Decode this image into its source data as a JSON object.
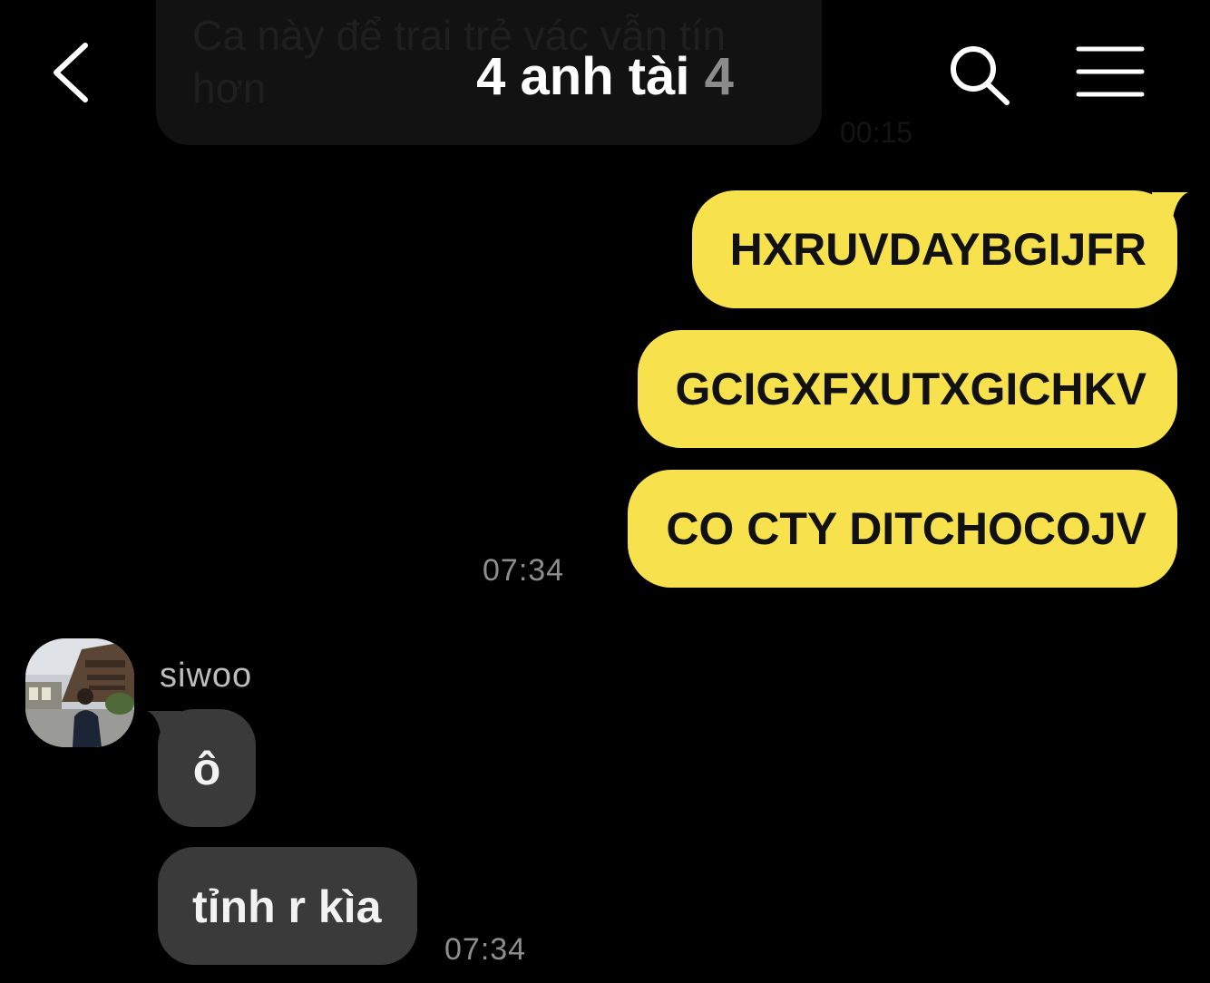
{
  "previous_message": {
    "text": "Ca này để trai trẻ vác vẫn tín hơn",
    "time": "00:15"
  },
  "header": {
    "title": "4 anh tài",
    "member_count": "4",
    "back_icon": "chevron-left-icon",
    "search_icon": "search-icon",
    "menu_icon": "menu-icon"
  },
  "colors": {
    "background": "#000000",
    "outgoing_bubble": "#f7e14c",
    "incoming_bubble": "#3a3a3a",
    "timestamp": "#8e8e8e"
  },
  "outgoing": {
    "messages": [
      "HXRUVDAYBGIJFR",
      "GCIGXFXUTXGICHKV",
      "CO CTY DITCHOCOJV"
    ],
    "time": "07:34"
  },
  "incoming": {
    "sender": "siwoo",
    "messages": [
      "ô",
      "tỉnh r kìa"
    ],
    "time": "07:34"
  }
}
